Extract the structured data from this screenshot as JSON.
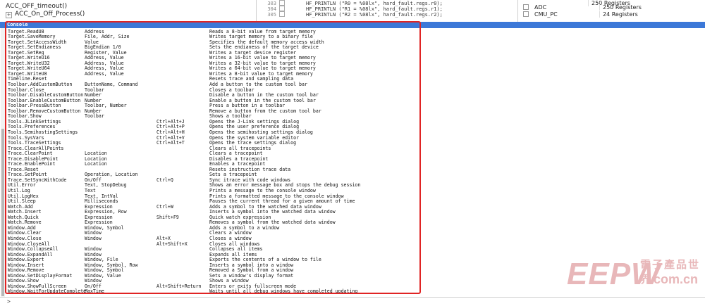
{
  "tree": {
    "items": [
      "ACC_OFF_timeout()",
      "ACC_On_Off_Process()"
    ]
  },
  "code": {
    "lines": [
      {
        "num": "303",
        "text": "HF_PRINTLN (\"R0 = %08lx\", hard_fault.regs.r0);"
      },
      {
        "num": "304",
        "text": "HF_PRINTLN (\"R1 = %08lx\", hard_fault.regs.r1);"
      },
      {
        "num": "305",
        "text": "HF_PRINTLN (\"R2 = %08lx\", hard_fault.regs.r2);"
      }
    ]
  },
  "registers": {
    "header_value": "250 Registers",
    "rows": [
      {
        "name": "ADC",
        "value": "250 Registers"
      },
      {
        "name": "CMU_PC",
        "value": "24 Registers"
      }
    ]
  },
  "console": {
    "title": "Console",
    "rows": [
      {
        "cmd": "Target.ReadU8",
        "args": "Address",
        "key": "",
        "desc": "Reads a 8-bit value from target memory"
      },
      {
        "cmd": "Target.SaveMemory",
        "args": "File, Addr, Size",
        "key": "",
        "desc": "Writes target memory to a binary file"
      },
      {
        "cmd": "Target.SetAccessWidth",
        "args": "Value",
        "key": "",
        "desc": "Specifies the default memory access width"
      },
      {
        "cmd": "Target.SetEndianess",
        "args": "BigEndian 1/0",
        "key": "",
        "desc": "Sets the endianess of the target device"
      },
      {
        "cmd": "Target.SetReg",
        "args": "Register, Value",
        "key": "",
        "desc": "Writes a target device register"
      },
      {
        "cmd": "Target.WriteU16",
        "args": "Address, Value",
        "key": "",
        "desc": "Writes a 16-bit value to target memory"
      },
      {
        "cmd": "Target.WriteU32",
        "args": "Address, Value",
        "key": "",
        "desc": "Writes a 32-bit value to target memory"
      },
      {
        "cmd": "Target.WriteU64",
        "args": "Address, Value",
        "key": "",
        "desc": "Writes a 64-bit value to target memory"
      },
      {
        "cmd": "Target.WriteU8",
        "args": "Address, Value",
        "key": "",
        "desc": "Writes a 8-bit value to target memory"
      },
      {
        "cmd": "Timeline.Reset",
        "args": "",
        "key": "",
        "desc": "Resets trace and sampling data"
      },
      {
        "cmd": "Toolbar.AddCustomButton",
        "args": "ButtonName, Command",
        "key": "",
        "desc": "Add a button to the custom tool bar"
      },
      {
        "cmd": "Toolbar.Close",
        "args": "Toolbar",
        "key": "",
        "desc": "Closes a toolbar"
      },
      {
        "cmd": "Toolbar.DisableCustomButton",
        "args": "Number",
        "key": "",
        "desc": "Disable a button in the custom tool bar"
      },
      {
        "cmd": "Toolbar.EnableCustomButton",
        "args": "Number",
        "key": "",
        "desc": "Enable a button in the custom tool bar"
      },
      {
        "cmd": "Toolbar.PressButton",
        "args": "Toolbar, Number",
        "key": "",
        "desc": "Press a button in a toolbar"
      },
      {
        "cmd": "Toolbar.RemoveCustomButton",
        "args": "Number",
        "key": "",
        "desc": "Remove a button from the custom tool bar"
      },
      {
        "cmd": "Toolbar.Show",
        "args": "Toolbar",
        "key": "",
        "desc": "Shows a toolbar"
      },
      {
        "cmd": "Tools.JLinkSettings",
        "args": "",
        "key": "Ctrl+Alt+J",
        "desc": "Opens the J-Link settings dialog"
      },
      {
        "cmd": "Tools.Preferences",
        "args": "",
        "key": "Ctrl+Alt+P",
        "desc": "Opens the user preference dialog"
      },
      {
        "cmd": "Tools.SemihostingSettings",
        "args": "",
        "key": "Ctrl+Alt+H",
        "desc": "Opens the semihosting settings dialog"
      },
      {
        "cmd": "Tools.SysVars",
        "args": "",
        "key": "Ctrl+Alt+V",
        "desc": "Opens the system variable editor"
      },
      {
        "cmd": "Tools.TraceSettings",
        "args": "",
        "key": "Ctrl+Alt+T",
        "desc": "Opens the trace settings dialog"
      },
      {
        "cmd": "Trace.ClearAllPoints",
        "args": "",
        "key": "",
        "desc": "Clears all tracepoints"
      },
      {
        "cmd": "Trace.ClearPoint",
        "args": "Location",
        "key": "",
        "desc": "Clears a tracepoint"
      },
      {
        "cmd": "Trace.DisablePoint",
        "args": "Location",
        "key": "",
        "desc": "Disables a tracepoint"
      },
      {
        "cmd": "Trace.EnablePoint",
        "args": "Location",
        "key": "",
        "desc": "Enables a tracepoint"
      },
      {
        "cmd": "Trace.Reset",
        "args": "",
        "key": "",
        "desc": "Resets instruction trace data"
      },
      {
        "cmd": "Trace.SetPoint",
        "args": "Operation, Location",
        "key": "",
        "desc": "Sets a tracepoint"
      },
      {
        "cmd": "Trace.SetSyncWithCode",
        "args": "On/Off",
        "key": "Ctrl+Q",
        "desc": "Sync itrace with code windows"
      },
      {
        "cmd": "Util.Error",
        "args": "Text, StopDebug",
        "key": "",
        "desc": "Shows an error message box and stops the debug session"
      },
      {
        "cmd": "Util.Log",
        "args": "Text",
        "key": "",
        "desc": "Prints a message to the console window"
      },
      {
        "cmd": "Util.LogHex",
        "args": "Text, IntVal",
        "key": "",
        "desc": "Prints a formatted message to the console window"
      },
      {
        "cmd": "Util.Sleep",
        "args": "Milliseconds",
        "key": "",
        "desc": "Pauses the current thread for a given amount of time"
      },
      {
        "cmd": "Watch.Add",
        "args": "Expression",
        "key": "Ctrl+W",
        "desc": "Adds a symbol to the watched data window"
      },
      {
        "cmd": "Watch.Insert",
        "args": "Expression, Row",
        "key": "",
        "desc": "Inserts a symbol into the watched data window"
      },
      {
        "cmd": "Watch.Quick",
        "args": "Expression",
        "key": "Shift+F9",
        "desc": "Quick watch expression"
      },
      {
        "cmd": "Watch.Remove",
        "args": "Expression",
        "key": "",
        "desc": "Removes a symbol from the watched data window"
      },
      {
        "cmd": "Window.Add",
        "args": "Window, Symbol",
        "key": "",
        "desc": "Adds a symbol to a window"
      },
      {
        "cmd": "Window.Clear",
        "args": "Window",
        "key": "",
        "desc": "Clears a window"
      },
      {
        "cmd": "Window.Close",
        "args": "Window",
        "key": "Alt+X",
        "desc": "Closes a window"
      },
      {
        "cmd": "Window.CloseAll",
        "args": "",
        "key": "Alt+Shift+X",
        "desc": "Closes all windows"
      },
      {
        "cmd": "Window.CollapseAll",
        "args": "Window",
        "key": "",
        "desc": "Collapses all items"
      },
      {
        "cmd": "Window.ExpandAll",
        "args": "Window",
        "key": "",
        "desc": "Expands all items"
      },
      {
        "cmd": "Window.Export",
        "args": "Window, File",
        "key": "",
        "desc": "Exports the contents of a window to file"
      },
      {
        "cmd": "Window.Insert",
        "args": "Window, Symbol, Row",
        "key": "",
        "desc": "Inserts a symbol into a window"
      },
      {
        "cmd": "Window.Remove",
        "args": "Window, Symbol",
        "key": "",
        "desc": "Removed a Symbol from a window"
      },
      {
        "cmd": "Window.SetDisplayFormat",
        "args": "Window, Value",
        "key": "",
        "desc": "Sets a window's display format"
      },
      {
        "cmd": "Window.Show",
        "args": "Window",
        "key": "",
        "desc": "Shows a window"
      },
      {
        "cmd": "Window.ShowFullScreen",
        "args": "On/Off",
        "key": "Alt+Shift+Return",
        "desc": "Enters or exits fullscreen mode"
      },
      {
        "cmd": "Window.WaitForUpdateComplete",
        "args": "MaxTime",
        "key": "",
        "desc": "Waits until all debug windows have completed updating"
      }
    ]
  },
  "command_line": {
    "prompt": ">"
  },
  "watermark": {
    "logo": "EEPW",
    "chinese": "電子產品世界",
    "domain": ".com.cn"
  }
}
